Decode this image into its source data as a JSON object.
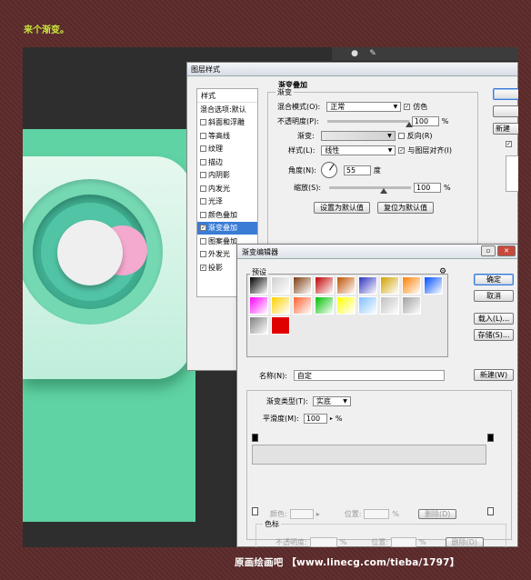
{
  "caption": "来个渐变。",
  "colors": {
    "mint": "#5fd3a3",
    "pink": "#f4a9cf",
    "selection": "#3a7bd5"
  },
  "layer_style": {
    "title": "图层样式",
    "list_header": "样式",
    "list_items": [
      {
        "label": "混合选项:默认",
        "checkbox": false,
        "checked": false,
        "indent": false,
        "selected": false
      },
      {
        "label": "斜面和浮雕",
        "checkbox": true,
        "checked": false,
        "indent": false,
        "selected": false
      },
      {
        "label": "等高线",
        "checkbox": true,
        "checked": false,
        "indent": true,
        "selected": false
      },
      {
        "label": "纹理",
        "checkbox": true,
        "checked": false,
        "indent": true,
        "selected": false
      },
      {
        "label": "描边",
        "checkbox": true,
        "checked": false,
        "indent": false,
        "selected": false
      },
      {
        "label": "内阴影",
        "checkbox": true,
        "checked": false,
        "indent": false,
        "selected": false
      },
      {
        "label": "内发光",
        "checkbox": true,
        "checked": false,
        "indent": false,
        "selected": false
      },
      {
        "label": "光泽",
        "checkbox": true,
        "checked": false,
        "indent": false,
        "selected": false
      },
      {
        "label": "颜色叠加",
        "checkbox": true,
        "checked": false,
        "indent": false,
        "selected": false
      },
      {
        "label": "渐变叠加",
        "checkbox": true,
        "checked": true,
        "indent": false,
        "selected": true
      },
      {
        "label": "图案叠加",
        "checkbox": true,
        "checked": false,
        "indent": false,
        "selected": false
      },
      {
        "label": "外发光",
        "checkbox": true,
        "checked": false,
        "indent": false,
        "selected": false
      },
      {
        "label": "投影",
        "checkbox": true,
        "checked": true,
        "indent": false,
        "selected": false
      }
    ],
    "section_title": "渐变叠加",
    "group_label": "渐变",
    "blend_mode_label": "混合模式(O):",
    "blend_mode_value": "正常",
    "dither_label": "仿色",
    "dither_checked": true,
    "opacity_label": "不透明度(P):",
    "opacity_value": "100",
    "opacity_unit": "%",
    "gradient_label": "渐变:",
    "reverse_label": "反向(R)",
    "reverse_checked": false,
    "style_label": "样式(L):",
    "style_value": "线性",
    "align_label": "与图层对齐(I)",
    "align_checked": true,
    "angle_label": "角度(N):",
    "angle_value": "55",
    "angle_unit": "度",
    "scale_label": "缩放(S):",
    "scale_value": "100",
    "scale_unit": "%",
    "make_default_button": "设置为默认值",
    "reset_default_button": "复位为默认值",
    "new_style_partial": "新建",
    "preview_checked": true
  },
  "gradient_editor": {
    "title": "渐变编辑器",
    "presets_label": "预设",
    "ok_button": "确定",
    "cancel_button": "取消",
    "load_button": "载入(L)...",
    "save_button": "存储(S)...",
    "name_label": "名称(N):",
    "name_value": "自定",
    "new_button": "新建(W)",
    "type_label": "渐变类型(T):",
    "type_value": "实底",
    "smoothness_label": "平滑度(M):",
    "smoothness_value": "100",
    "smoothness_unit": "%",
    "stops_group": "色标",
    "stop_opacity_label": "不透明度:",
    "stop_color_label": "颜色:",
    "location_label": "位置:",
    "percent": "%",
    "delete_button": "删除(D)",
    "swatch_colors": [
      [
        "#000000",
        "#d0d0d0",
        "#7a3b10",
        "#c00000",
        "#c05000",
        "#3030c0",
        "#d0a000",
        "#ff8000",
        "#0050ff"
      ],
      [
        "#ff00ff",
        "#ffd000",
        "#ff6030",
        "#00c000",
        "#ffff00",
        "#80c0ff",
        "#c0c0c0",
        "#a0a0a0"
      ],
      [
        "#808080",
        "#e00000"
      ]
    ]
  },
  "footer": "原画绘画吧 【www.linecg.com/tieba/1797】"
}
